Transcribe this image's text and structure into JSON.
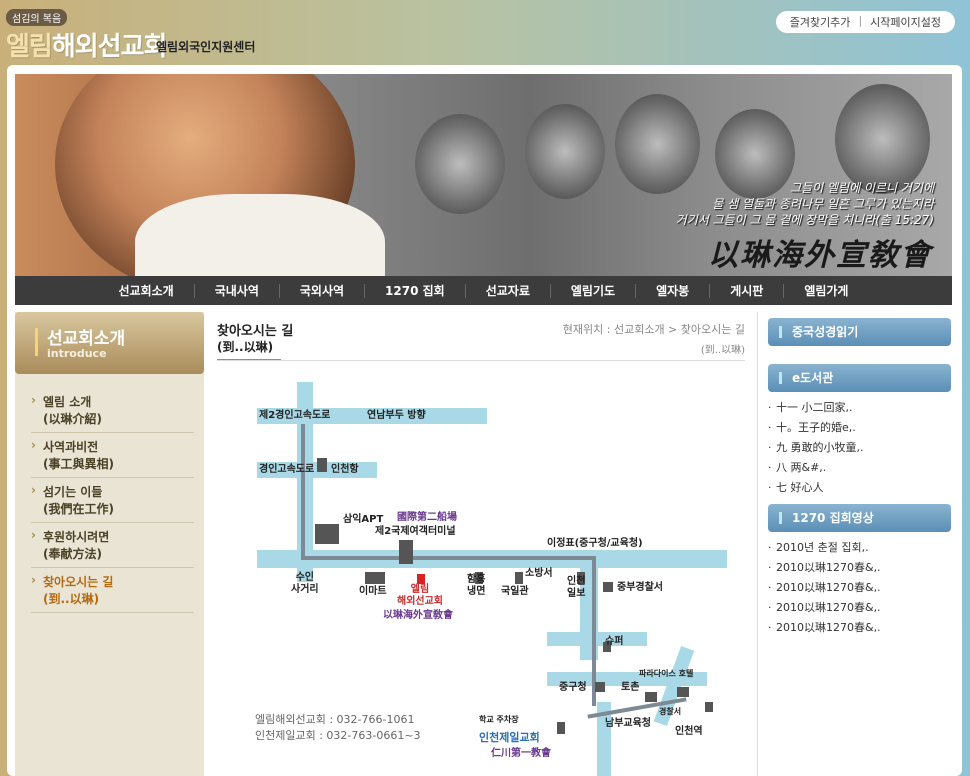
{
  "header": {
    "slogan": "섬김의 복음",
    "logo_accent": "엘림",
    "logo_main": "해외선교회",
    "logo_sub": "엘림외국인지원센터",
    "toplinks": [
      "즐겨찾기추가",
      "시작페이지설정"
    ],
    "toplink_sep": "|"
  },
  "hero": {
    "quote": [
      "그들이 엘림에 이르니 거기에",
      "물 샘 열둘과 종려나무 일흔 그루가 있는지라",
      "거기서 그들이 그 물 곁에 장막을 치니라(출 15:27)"
    ],
    "brand": "以琳海外宣敎會"
  },
  "nav": [
    "선교회소개",
    "국내사역",
    "국외사역",
    "1270 집회",
    "선교자료",
    "엘림기도",
    "엘자봉",
    "게시판",
    "엘림가게"
  ],
  "sidebar": {
    "title": "선교회소개",
    "title_en": "introduce",
    "items": [
      {
        "label": "엘림 소개",
        "sub": "(以琳介紹)"
      },
      {
        "label": "사역과비전",
        "sub": "(事工與異相)"
      },
      {
        "label": "섬기는 이들",
        "sub": "(我們在工作)"
      },
      {
        "label": "후원하시려면",
        "sub": "(奉献方法)"
      },
      {
        "label": "찾아오시는 길",
        "sub": "(到..以琳)"
      }
    ]
  },
  "content": {
    "title": "찾아오시는 길",
    "subtitle": "(到..以琳)",
    "breadcrumb": "현재위치 : 선교회소개 > 찾아오시는 길",
    "breadcrumb_sub": "(到..以琳)",
    "map_labels": {
      "l1": "제2경인고속도로",
      "l2": "연남부두 방향",
      "l3": "경인고속도로",
      "l4": "인천항",
      "l5": "삼익APT",
      "l6": "國際第二船場",
      "l7": "제2국제여객터미널",
      "l8": "이정표(중구청/교육청)",
      "l9a": "수인",
      "l9b": "사거리",
      "l10": "이마트",
      "l11a": "엘림",
      "l11b": "해외선교회",
      "l12": "以琳海外宣敎會",
      "l13a": "함흥",
      "l13b": "냉면",
      "l14": "국일관",
      "l15": "소방서",
      "l16a": "인천",
      "l16b": "일보",
      "l17": "중부경찰서",
      "l18": "슈퍼",
      "l19": "중구청",
      "l20": "토촌",
      "l21": "파라다이스 호텔",
      "l22": "경찰서",
      "l23": "학교 주차장",
      "l24": "남부교육청",
      "l25": "인천역",
      "l26": "인천제일교회",
      "l27": "仁川第一教會"
    },
    "contact": [
      "엘림해외선교회 : 032-766-1061",
      "인천제일교회 : 032-763-0661~3"
    ]
  },
  "right": {
    "section1": {
      "title": "중국성경읽기"
    },
    "section2": {
      "title": "e도서관",
      "items": [
        "十一 小二回家,.",
        "十。王子的婚e,.",
        "九 勇敢的小牧童,.",
        "八 两&#,.",
        "七 好心人"
      ]
    },
    "section3": {
      "title": "1270 집회영상",
      "items": [
        "2010년 춘절 집회,.",
        "2010以琳1270春&,.",
        "2010以琳1270春&,.",
        "2010以琳1270春&,.",
        "2010以琳1270春&,."
      ]
    }
  }
}
